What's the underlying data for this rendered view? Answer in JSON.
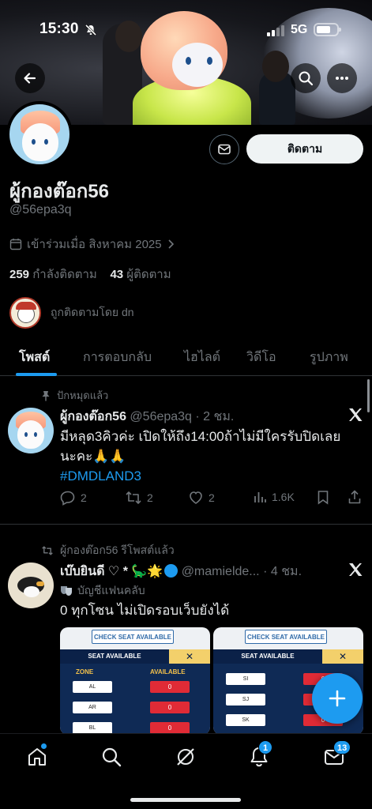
{
  "status_bar": {
    "time": "15:30",
    "network": "5G"
  },
  "profile": {
    "display_name": "ผู้กองต๊อก56",
    "handle": "@56epa3q",
    "joined": "เข้าร่วมเมื่อ สิงหาคม 2025",
    "following_count": "259",
    "following_label": "กำลังติดตาม",
    "followers_count": "43",
    "followers_label": "ผู้ติดตาม",
    "followed_by": "ถูกติดตามโดย dn",
    "follow_button": "ติดตาม"
  },
  "tabs": [
    {
      "label": "โพสต์",
      "active": true
    },
    {
      "label": "การตอบกลับ",
      "active": false
    },
    {
      "label": "ไฮไลต์",
      "active": false
    },
    {
      "label": "วิดีโอ",
      "active": false
    },
    {
      "label": "รูปภาพ",
      "active": false
    }
  ],
  "posts": [
    {
      "pinned_label": "ปักหมุดแล้ว",
      "author": "ผู้กองต๊อก56",
      "meta": "@56epa3q · 2 ชม.",
      "text_line1": "มีหลุด3คิวค่ะ เปิดให้ถึง14:00ถ้าไม่มีใครรับปิดเลย",
      "text_line2": "นะคะ🙏🙏",
      "hashtag": "#DMDLAND3",
      "replies": "2",
      "reposts": "2",
      "likes": "2",
      "views": "1.6K"
    },
    {
      "repost_label": "ผู้กองต๊อก56 รีโพสต์แล้ว",
      "author": "เบ๊บยินดี ♡ * 🦕🌟",
      "meta": "@mamielde... · 4 ชม.",
      "fan_label": "บัญชีแฟนคลับ",
      "text": "0 ทุกโซน ไม่เปิดรอบเว็บยังได้"
    }
  ],
  "seat_images": [
    {
      "check_label": "CHECK SEAT AVAILABLE",
      "title": "SEAT AVAILABLE",
      "zone_header": "ZONE",
      "available_header": "AVAILABLE",
      "rows": [
        {
          "zone": "AL",
          "available": "0"
        },
        {
          "zone": "AR",
          "available": "0"
        },
        {
          "zone": "BL",
          "available": "0"
        }
      ]
    },
    {
      "check_label": "CHECK SEAT AVAILABLE",
      "title": "SEAT AVAILABLE",
      "rows": [
        {
          "zone": "SI",
          "available": "0"
        },
        {
          "zone": "SJ",
          "available": "0"
        },
        {
          "zone": "SK",
          "available": "0"
        }
      ]
    }
  ],
  "nav": {
    "notifications_badge": "1",
    "messages_badge": "13"
  },
  "colors": {
    "accent": "#1d9bf0",
    "background": "#000000",
    "muted_text": "#71767b",
    "seat_red": "#e02b36"
  }
}
